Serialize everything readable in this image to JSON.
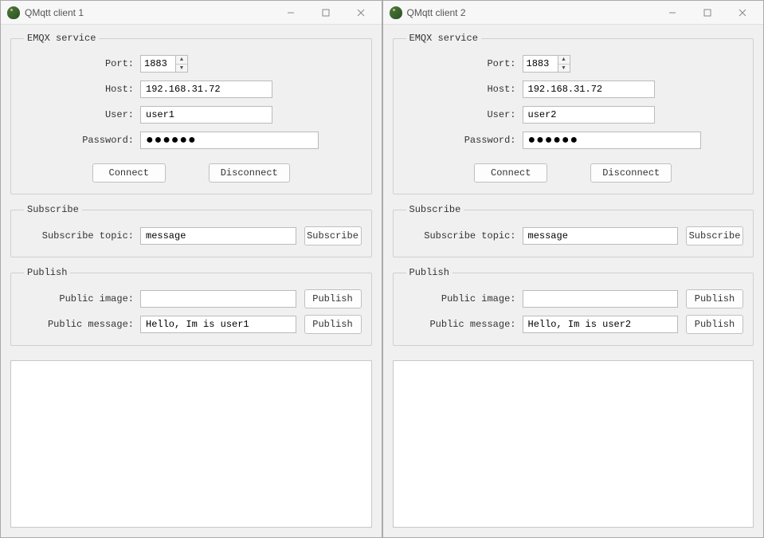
{
  "windows": [
    {
      "title": "QMqtt client 1",
      "emqx": {
        "legend": "EMQX service",
        "port_label": "Port:",
        "port_value": "1883",
        "host_label": "Host:",
        "host_value": "192.168.31.72",
        "user_label": "User:",
        "user_value": "user1",
        "password_label": "Password:",
        "password_masked": "●●●●●●",
        "connect_btn": "Connect",
        "disconnect_btn": "Disconnect"
      },
      "subscribe": {
        "legend": "Subscribe",
        "topic_label": "Subscribe topic:",
        "topic_value": "message",
        "btn": "Subscribe"
      },
      "publish": {
        "legend": "Publish",
        "image_label": "Public image:",
        "image_value": "",
        "image_btn": "Publish",
        "message_label": "Public message:",
        "message_value": "Hello, Im is user1",
        "message_btn": "Publish"
      }
    },
    {
      "title": "QMqtt client 2",
      "emqx": {
        "legend": "EMQX service",
        "port_label": "Port:",
        "port_value": "1883",
        "host_label": "Host:",
        "host_value": "192.168.31.72",
        "user_label": "User:",
        "user_value": "user2",
        "password_label": "Password:",
        "password_masked": "●●●●●●",
        "connect_btn": "Connect",
        "disconnect_btn": "Disconnect"
      },
      "subscribe": {
        "legend": "Subscribe",
        "topic_label": "Subscribe topic:",
        "topic_value": "message",
        "btn": "Subscribe"
      },
      "publish": {
        "legend": "Publish",
        "image_label": "Public image:",
        "image_value": "",
        "image_btn": "Publish",
        "message_label": "Public message:",
        "message_value": "Hello, Im is user2",
        "message_btn": "Publish"
      }
    }
  ]
}
